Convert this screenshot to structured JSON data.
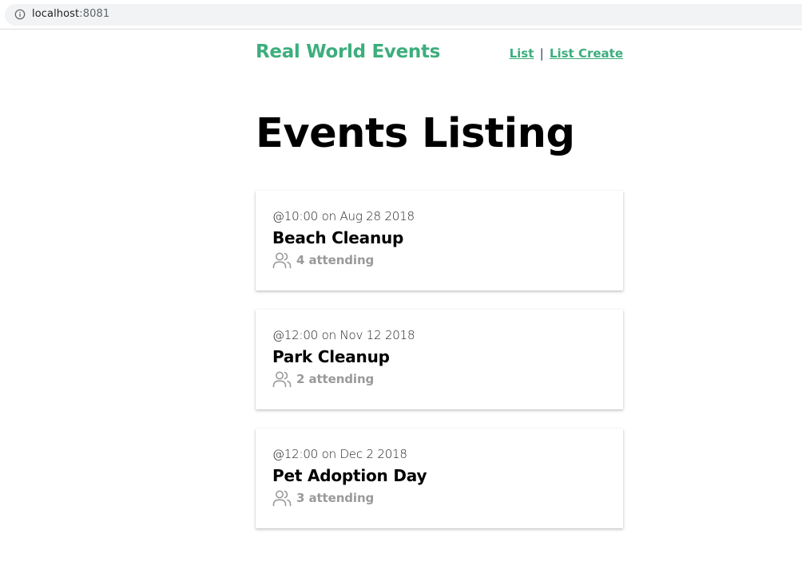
{
  "browser": {
    "url_host": "localhost",
    "url_port": ":8081"
  },
  "nav": {
    "brand": "Real World Events",
    "links": [
      "List",
      "List Create"
    ],
    "separator": "|"
  },
  "page": {
    "title": "Events Listing"
  },
  "events": [
    {
      "time": "@10:00 on Aug 28 2018",
      "title": "Beach Cleanup",
      "attending": "4 attending"
    },
    {
      "time": "@12:00 on Nov 12 2018",
      "title": "Park Cleanup",
      "attending": "2 attending"
    },
    {
      "time": "@12:00 on Dec 2 2018",
      "title": "Pet Adoption Day",
      "attending": "3 attending"
    }
  ],
  "colors": {
    "accent": "#3dae7d",
    "muted": "#9a9a9a"
  },
  "icons": {
    "address_bar": "info-icon",
    "attendees": "users-icon"
  }
}
